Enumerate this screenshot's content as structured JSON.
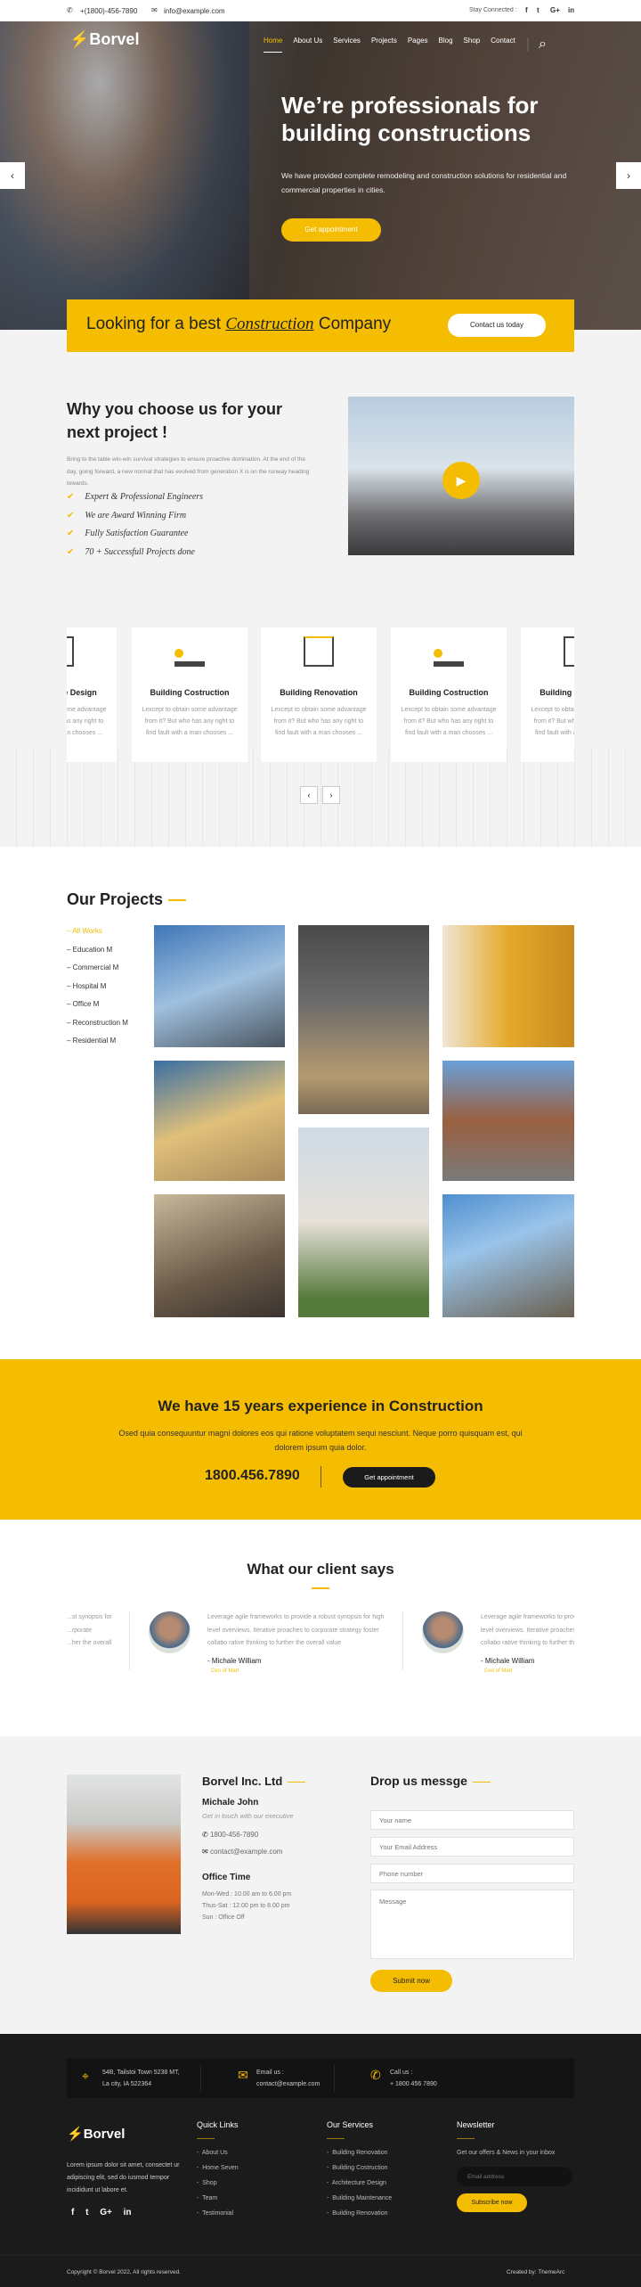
{
  "topbar": {
    "phone": "+(1800)-456-7890",
    "email": "info@example.com",
    "stay_connected": "Stay Connected :",
    "social": [
      "f",
      "🐦",
      "G+",
      "in"
    ]
  },
  "nav": {
    "logo": "Borvel",
    "items": [
      "Home",
      "About Us",
      "Services",
      "Projects",
      "Pages",
      "Blog",
      "Shop",
      "Contact"
    ],
    "active": "Home"
  },
  "hero": {
    "title_line1": "We’re professionals for",
    "title_line2": "building constructions",
    "text": "We have provided complete remodeling and construction solutions for residential and commercial properties in cities.",
    "button": "Get appointment",
    "prev": "‹",
    "next": "›"
  },
  "banner": {
    "pre": "Looking for a best",
    "highlight": "Construction",
    "post": "Company",
    "button": "Contact us today"
  },
  "about": {
    "title": "Why you choose us for your next project !",
    "text": "Bring to the table win-win survival strategies to ensure proactive domination. At the end of the day, going forward, a new normal that has evolved from generation X is on the runway heading towards.",
    "features": [
      "Expert & Professional Engineers",
      "We are Award Winning Firm",
      "Fully Satisfaction Guarantee",
      "70 + Successfull Projects done"
    ]
  },
  "services": {
    "cards": [
      {
        "title": "Architecture Design",
        "visible_title": "Design",
        "text": "Lexcept to obtain some advantage from it? But who has any right to find fault with a man chooses ...",
        "icon": "blueprint-icon"
      },
      {
        "title": "Building Costruction",
        "text": "Lexcept to obtain some advantage from it? But who has any right to find fault with a man chooses ...",
        "icon": "crane-icon"
      },
      {
        "title": "Building Renovation",
        "text": "Lexcept to obtain some advantage from it? But who has any right to find fault with a man chooses ...",
        "icon": "paint-brush-icon"
      },
      {
        "title": "Building Costruction",
        "text": "Lexcept to obtain some advantage from it? But who has any right to find fault with a man chooses ...",
        "icon": "crane-icon"
      },
      {
        "title": "Building Renovation",
        "visible_title": "Building",
        "text": "Lexcept to obtain some advantage from it? But who has any right to find fault with a man chooses ...",
        "icon": "paint-brush-icon"
      }
    ],
    "prev": "‹",
    "next": "›"
  },
  "projects": {
    "title": "Our Projects",
    "filters": [
      "All Works",
      "Education M",
      "Commercial M",
      "Hospital M",
      "Office M",
      "Reconstruction M",
      "Residential M"
    ],
    "active": "All Works"
  },
  "cta": {
    "title": "We have 15 years experience in Construction",
    "text": "Osed quia consequuntur magni dolores eos qui ratione voluptatem sequi nesciunt. Neque porro quisquam est, qui dolorem ipsum quia dolor.",
    "phone": "1800.456.7890",
    "button": "Get appointment"
  },
  "testimonials": {
    "title": "What our client says",
    "partial_left": "...st synopsis for\n...rporate\n...her the overall",
    "items": [
      {
        "text": "Leverage agile frameworks to provide a robust synopsis for high level overviews. Iterative proaches to corporate strategy foster collabo rative thinking to further the overall value",
        "name": "- Michale William",
        "role": "Ceo of Mart"
      },
      {
        "text": "Leverage agile frameworks to provide a robust synopsis for high level overviews. Iterative proaches to corporate strategy foster collabo rative thinking to further the overall value",
        "name": "- Michale William",
        "role": "Ceo of Mart"
      }
    ]
  },
  "contact": {
    "company": "Borvel Inc. Ltd",
    "person": "Michale John",
    "tagline": "Get in touch with our executive",
    "phone": "1800-456-7890",
    "email": "contact@example.com",
    "office_title": "Office Time",
    "hours": [
      "Mon-Wed : 10.00 am to 6.00 pm",
      "Thus-Sat : 12.00 pm to 8.00 pm",
      "Sun : Office Off"
    ]
  },
  "form": {
    "title": "Drop us messge",
    "name_placeholder": "Your name",
    "email_placeholder": "Your Email Address",
    "phone_placeholder": "Phone number",
    "message_placeholder": "Message",
    "submit": "Submit now"
  },
  "footer": {
    "info": [
      {
        "line1": "54B, Tailstoi Town 5238 MT,",
        "line2": "La city, IA 522364",
        "icon": "map-pin-icon"
      },
      {
        "line1": "Email us :",
        "line2": "contact@example.com",
        "icon": "envelope-icon"
      },
      {
        "line1": "Call us :",
        "line2": "+ 1800 456 7890",
        "icon": "phone-icon"
      }
    ],
    "logo": "Borvel",
    "about": "Lorem ipsum dolor sit amet, consectet ur adipiscing elit, sed do iusmod tempor incididunt ut labore et.",
    "social": [
      "f",
      "🐦",
      "G+",
      "in"
    ],
    "quick_title": "Quick Links",
    "quick": [
      "About Us",
      "Home Seven",
      "Shop",
      "Team",
      "Testimonial"
    ],
    "services_title": "Our Services",
    "services": [
      "Building Renovation",
      "Building Costruction",
      "Architecture Design",
      "Building Maintenance",
      "Building Renovation"
    ],
    "news_title": "Newsletter",
    "news_text": "Get our offers & News in your inbox",
    "news_placeholder": "Email address",
    "news_button": "Subscribe now",
    "copyright": "Copyright © Borvel 2022, All rights reserved.",
    "credit": "Created by: ThemeArc"
  },
  "colors": {
    "accent": "#f5bd02",
    "dark": "#1b1b1b",
    "light_bg": "#f3f3f3"
  }
}
